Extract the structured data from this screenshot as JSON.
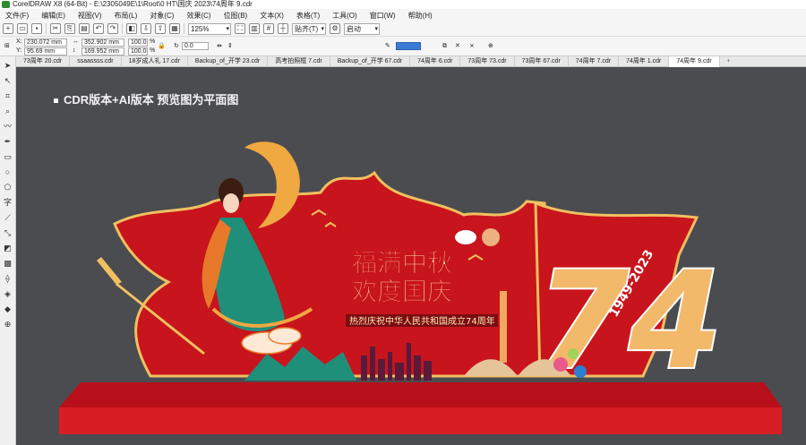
{
  "window": {
    "title": "CorelDRAW X8 (64-Bit) - E:\\2305049E\\1\\Root\\0 HT\\国庆 2023\\74周年 9.cdr"
  },
  "menu": [
    "文件(F)",
    "编辑(E)",
    "视图(V)",
    "布局(L)",
    "对象(C)",
    "效果(C)",
    "位图(B)",
    "文本(X)",
    "表格(T)",
    "工具(O)",
    "窗口(W)",
    "帮助(H)"
  ],
  "toolbar": {
    "zoom": "125%",
    "snap": "贴齐(T)",
    "launch": "启动"
  },
  "properties": {
    "x": "230.072 mm",
    "y": "95.69 mm",
    "width": "352.902 mm",
    "height": "169.952 mm",
    "scale_x": "100.0",
    "scale_y": "100.0",
    "percent": "%",
    "rotation": "0.0"
  },
  "tabs": [
    "73周年 20.cdr",
    "ssaassss.cdr",
    "18岁成人礼 17.cdr",
    "Backup_of_开学 23.cdr",
    "高考拍照框 7.cdr",
    "Backup_of_开学 67.cdr",
    "74周年 6.cdr",
    "73周年 73.cdr",
    "73周年 67.cdr",
    "74周年 7.cdr",
    "74周年 1.cdr",
    "74周年 9.cdr"
  ],
  "active_tab_index": 11,
  "canvas": {
    "note": "CDR版本+AI版本   预览图为平面图",
    "artwork": {
      "headline_1": "福满中秋",
      "headline_2": "欢度国庆",
      "subtitle": "热烈庆祝中华人民共和国成立74周年",
      "big_number": "74",
      "years": "1949-2023"
    }
  },
  "colors": {
    "canvas_bg": "#4b4c50",
    "red": "#c8141c",
    "gold": "#f0c060",
    "teal": "#1f8f7a"
  }
}
